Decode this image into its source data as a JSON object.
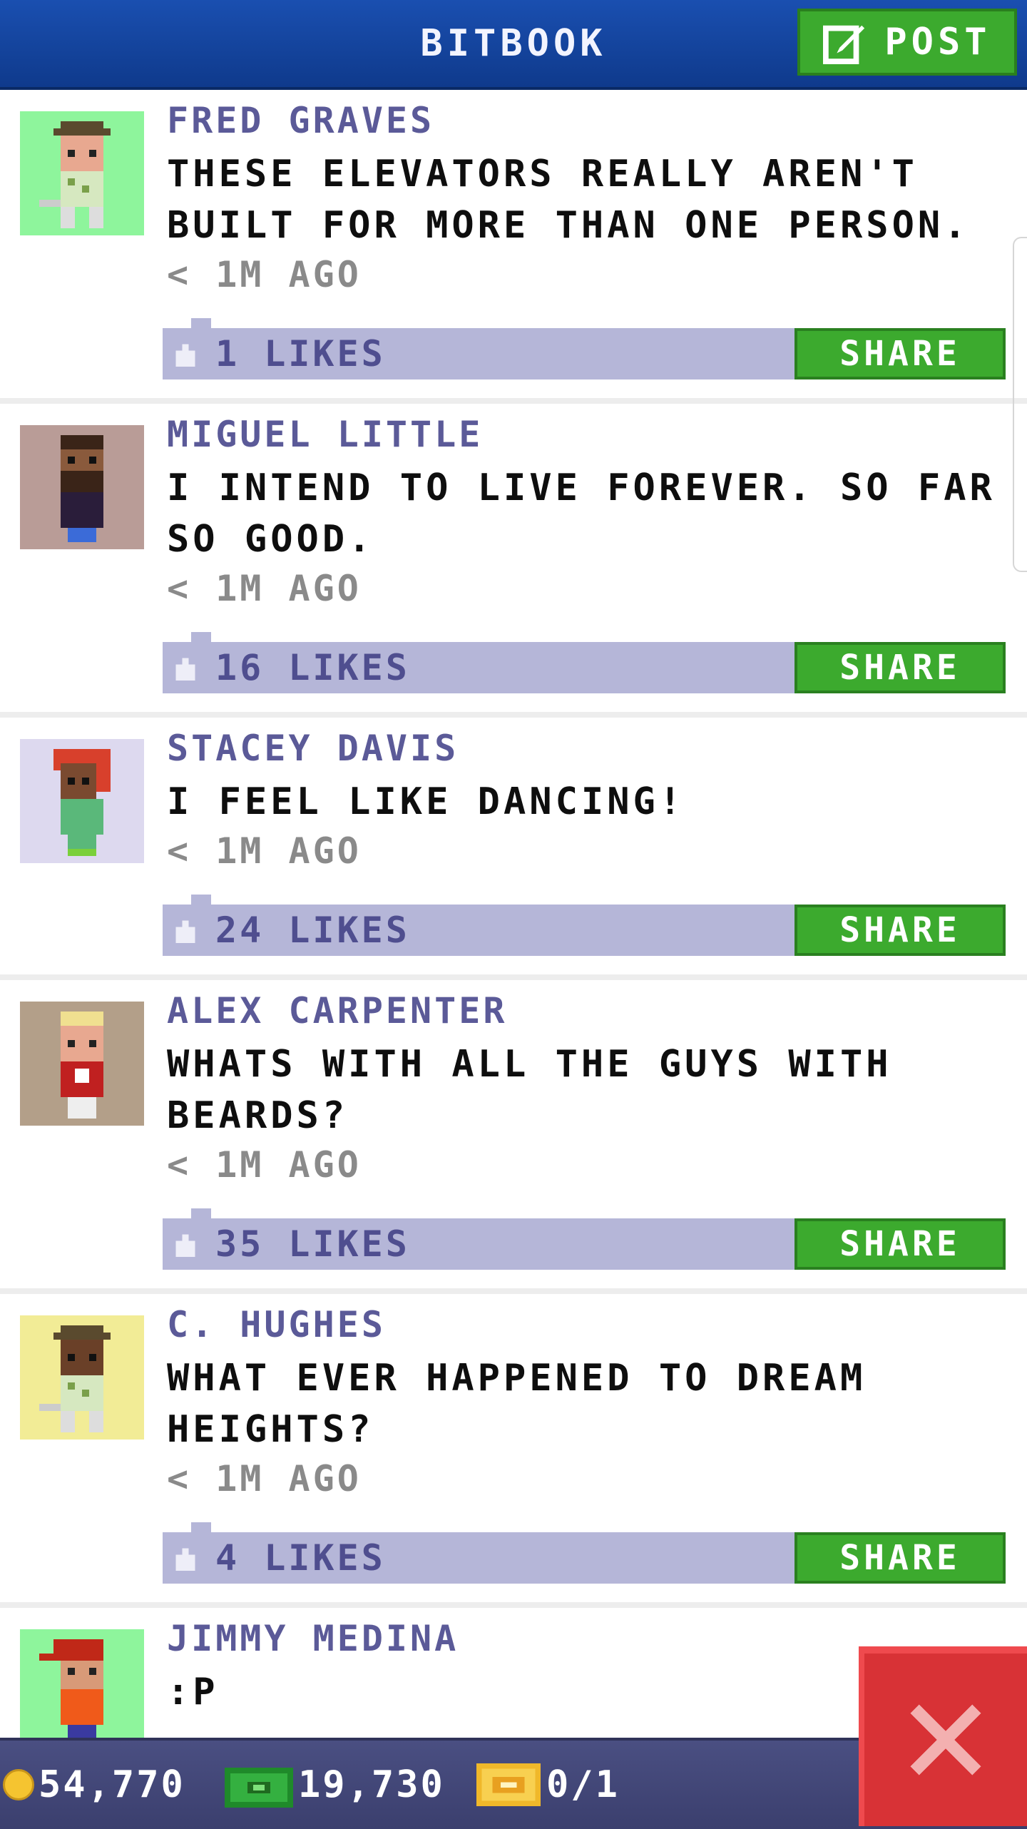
{
  "header": {
    "title": "BITBOOK",
    "post_label": "POST"
  },
  "posts": [
    {
      "author": "FRED GRAVES",
      "message": "THESE ELEVATORS REALLY AREN'T BUILT FOR MORE THAN ONE PERSON.",
      "time": "< 1M AGO",
      "likes": "1 LIKES",
      "share": "SHARE",
      "avatar_bg": "#8ef59c",
      "avatar": "golfer-avatar"
    },
    {
      "author": "MIGUEL LITTLE",
      "message": "I INTEND TO LIVE FOREVER. SO FAR SO GOOD.",
      "time": "< 1M AGO",
      "likes": "16 LIKES",
      "share": "SHARE",
      "avatar_bg": "#b99c97",
      "avatar": "bearded-man-avatar"
    },
    {
      "author": "STACEY DAVIS",
      "message": "I FEEL LIKE DANCING!",
      "time": "< 1M AGO",
      "likes": "24 LIKES",
      "share": "SHARE",
      "avatar_bg": "#ddd9ef",
      "avatar": "redhead-woman-avatar"
    },
    {
      "author": "ALEX CARPENTER",
      "message": "WHATS WITH ALL THE GUYS WITH BEARDS?",
      "time": "< 1M AGO",
      "likes": "35 LIKES",
      "share": "SHARE",
      "avatar_bg": "#b39f89",
      "avatar": "blonde-man-avatar"
    },
    {
      "author": "C. HUGHES",
      "message": "WHAT EVER HAPPENED TO DREAM HEIGHTS?",
      "time": "< 1M AGO",
      "likes": "4 LIKES",
      "share": "SHARE",
      "avatar_bg": "#f2ec96",
      "avatar": "golfer-avatar"
    },
    {
      "author": "JIMMY MEDINA",
      "message": ":P",
      "time": "",
      "likes": "",
      "share": "",
      "avatar_bg": "#8ef59c",
      "avatar": "cap-man-avatar"
    }
  ],
  "bottom_bar": {
    "coins": "54,770",
    "bux": "19,730",
    "tickets": "0/1"
  },
  "colors": {
    "header": "#1a4fb0",
    "accent_green": "#3caa2e",
    "likes_bar": "#b5b6d8",
    "author_text": "#5b5a98",
    "close_red": "#d83236"
  },
  "icons": [
    "edit-icon",
    "thumbs-up-icon",
    "coin-icon",
    "bux-icon",
    "ticket-icon",
    "close-icon"
  ]
}
